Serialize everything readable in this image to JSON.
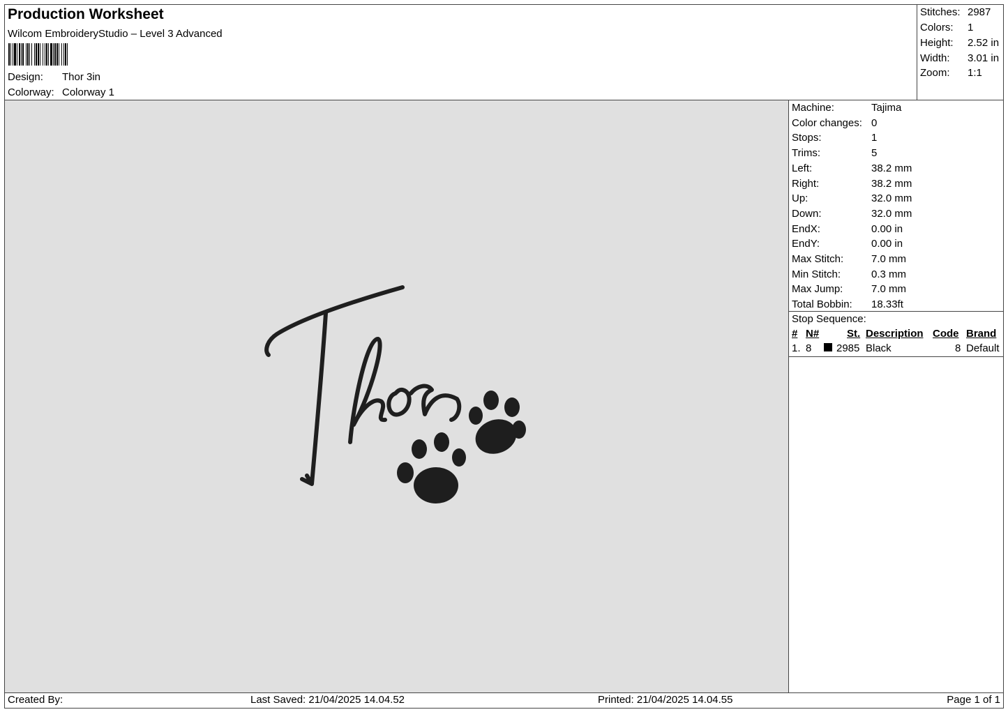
{
  "header": {
    "title": "Production Worksheet",
    "subtitle": "Wilcom EmbroideryStudio – Level 3 Advanced",
    "design_label": "Design:",
    "design_value": "Thor 3in",
    "colorway_label": "Colorway:",
    "colorway_value": "Colorway 1"
  },
  "stats": [
    {
      "label": "Stitches:",
      "value": "2987"
    },
    {
      "label": "Colors:",
      "value": "1"
    },
    {
      "label": "Height:",
      "value": "2.52 in"
    },
    {
      "label": "Width:",
      "value": "3.01 in"
    },
    {
      "label": "Zoom:",
      "value": "1:1"
    }
  ],
  "info": [
    {
      "label": "Machine:",
      "value": "Tajima"
    },
    {
      "label": "Color changes:",
      "value": "0"
    },
    {
      "label": "Stops:",
      "value": "1"
    },
    {
      "label": "Trims:",
      "value": "5"
    },
    {
      "label": "Left:",
      "value": "38.2 mm"
    },
    {
      "label": "Right:",
      "value": "38.2 mm"
    },
    {
      "label": "Up:",
      "value": "32.0 mm"
    },
    {
      "label": "Down:",
      "value": "32.0 mm"
    },
    {
      "label": "EndX:",
      "value": "0.00 in"
    },
    {
      "label": "EndY:",
      "value": "0.00 in"
    },
    {
      "label": "Max Stitch:",
      "value": "7.0 mm"
    },
    {
      "label": "Min Stitch:",
      "value": "0.3 mm"
    },
    {
      "label": "Max Jump:",
      "value": "7.0 mm"
    },
    {
      "label": "Total Bobbin:",
      "value": "18.33ft"
    }
  ],
  "stop_sequence": {
    "title": "Stop Sequence:",
    "columns": {
      "num": "#",
      "n": "N#",
      "st": "St.",
      "desc": "Description",
      "code": "Code",
      "brand": "Brand"
    },
    "rows": [
      {
        "num": "1.",
        "n": "8",
        "st": "2985",
        "desc": "Black",
        "code": "8",
        "brand": "Default",
        "color": "#000000"
      }
    ]
  },
  "design": {
    "background": "#e0e0e0",
    "thread_color": "#1a1a1a"
  },
  "footer": {
    "created_by": "Created By:",
    "last_saved": "Last Saved: 21/04/2025 14.04.52",
    "printed": "Printed: 21/04/2025 14.04.55",
    "page": "Page 1 of 1"
  }
}
